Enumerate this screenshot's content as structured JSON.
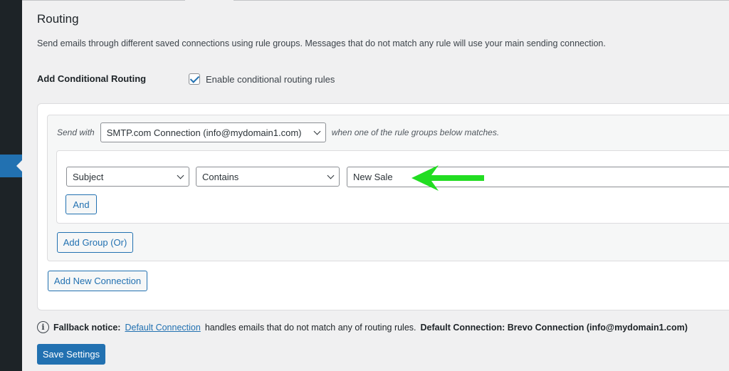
{
  "section": {
    "title": "Routing",
    "description": "Send emails through different saved connections using rule groups. Messages that do not match any rule will use your main sending connection."
  },
  "conditional_routing": {
    "label": "Add Conditional Routing",
    "checkbox_label": "Enable conditional routing rules",
    "checked": true
  },
  "connection": {
    "send_with_label": "Send with",
    "selected_connection": "SMTP.com Connection (info@mydomain1.com)",
    "match_note": "when one of the rule groups below matches."
  },
  "rule": {
    "field": "Subject",
    "operator": "Contains",
    "value": "New Sale"
  },
  "buttons": {
    "and": "And",
    "add_group": "Add Group (Or)",
    "add_new_connection": "Add New Connection",
    "save_settings": "Save Settings"
  },
  "fallback": {
    "prefix": "Fallback notice:",
    "link_text": "Default Connection",
    "middle_text": "handles emails that do not match any of routing rules.",
    "default_label": "Default Connection: Brevo Connection (info@mydomain1.com)"
  },
  "colors": {
    "accent": "#2271b1",
    "sidebar": "#1d2327",
    "arrow": "#22dd22"
  }
}
